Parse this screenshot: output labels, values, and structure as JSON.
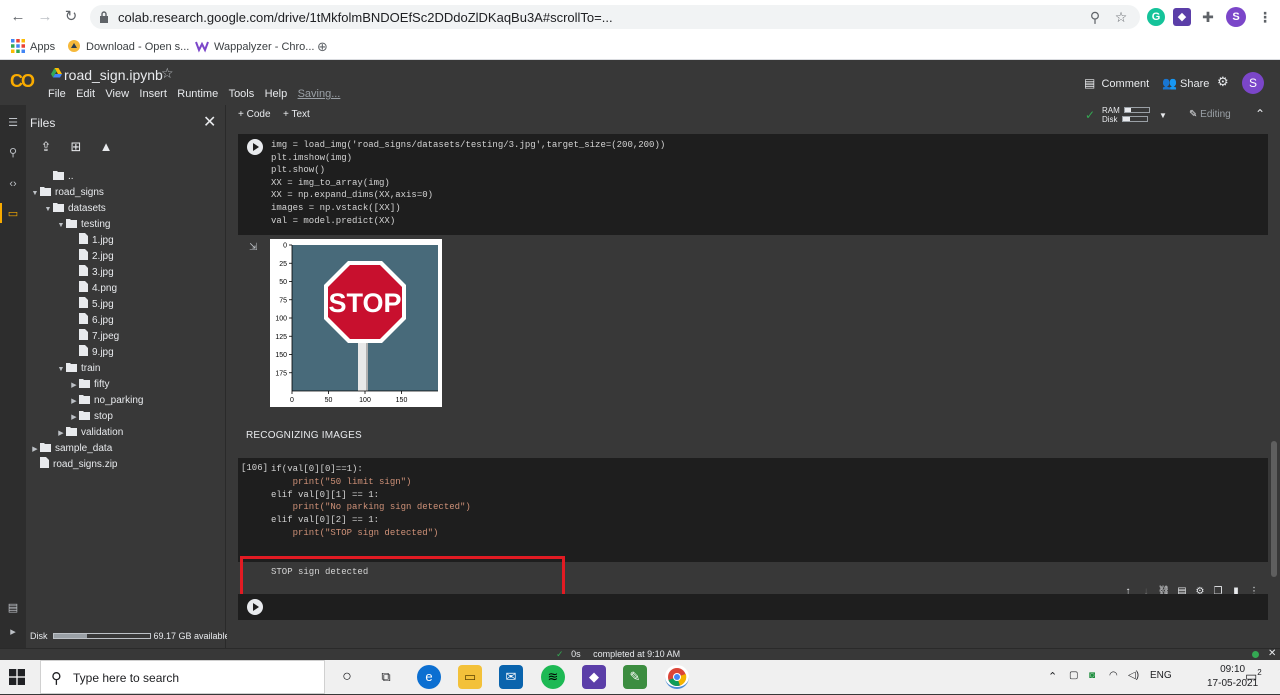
{
  "browser": {
    "url": "colab.research.google.com/drive/1tMkfolmBNDOEfSc2DDdoZlDKaqBu3A#scrollTo=..."
  },
  "bookmarks": [
    {
      "label": "Apps"
    },
    {
      "label": "Download - Open s..."
    },
    {
      "label": "Wappalyzer - Chro..."
    }
  ],
  "colab": {
    "logo": "CO",
    "notebook_title": "road_sign.ipynb",
    "menu": [
      "File",
      "Edit",
      "View",
      "Insert",
      "Runtime",
      "Tools",
      "Help"
    ],
    "saving": "Saving...",
    "comment_label": "Comment",
    "share_label": "Share",
    "avatar_letter": "S"
  },
  "files_panel": {
    "title": "Files",
    "tree": [
      {
        "label": "..",
        "type": "folder-up",
        "depth": 1
      },
      {
        "label": "road_signs",
        "type": "folder",
        "depth": 0,
        "open": true
      },
      {
        "label": "datasets",
        "type": "folder",
        "depth": 1,
        "open": true
      },
      {
        "label": "testing",
        "type": "folder",
        "depth": 2,
        "open": true
      },
      {
        "label": "1.jpg",
        "type": "file",
        "depth": 3
      },
      {
        "label": "2.jpg",
        "type": "file",
        "depth": 3
      },
      {
        "label": "3.jpg",
        "type": "file",
        "depth": 3
      },
      {
        "label": "4.png",
        "type": "file",
        "depth": 3
      },
      {
        "label": "5.jpg",
        "type": "file",
        "depth": 3
      },
      {
        "label": "6.jpg",
        "type": "file",
        "depth": 3
      },
      {
        "label": "7.jpeg",
        "type": "file",
        "depth": 3
      },
      {
        "label": "9.jpg",
        "type": "file",
        "depth": 3
      },
      {
        "label": "train",
        "type": "folder",
        "depth": 2,
        "open": true
      },
      {
        "label": "fifty",
        "type": "folder",
        "depth": 3,
        "open": false
      },
      {
        "label": "no_parking",
        "type": "folder",
        "depth": 3,
        "open": false
      },
      {
        "label": "stop",
        "type": "folder",
        "depth": 3,
        "open": false
      },
      {
        "label": "validation",
        "type": "folder",
        "depth": 2,
        "open": false
      },
      {
        "label": "sample_data",
        "type": "folder",
        "depth": 0,
        "open": false
      },
      {
        "label": "road_signs.zip",
        "type": "file",
        "depth": 0
      }
    ],
    "disk_label": "Disk",
    "disk_available": "69.17 GB available",
    "disk_used_fraction": 0.35
  },
  "toolbar": {
    "add_code": "+ Code",
    "add_text": "+ Text",
    "ram_label": "RAM",
    "disk_label": "Disk",
    "editing_label": "Editing",
    "ram_fraction": 0.25,
    "disk_fraction": 0.3
  },
  "cell1": {
    "lines": [
      "img = load_img('road_signs/datasets/testing/3.jpg',target_size=(200,200))",
      "plt.imshow(img)",
      "plt.show()",
      "XX = img_to_array(img)",
      "XX = np.expand_dims(XX,axis=0)",
      "images = np.vstack([XX])",
      "val = model.predict(XX)"
    ]
  },
  "plot": {
    "y_ticks": [
      "0",
      "25",
      "50",
      "75",
      "100",
      "125",
      "150",
      "175"
    ],
    "x_ticks": [
      "0",
      "50",
      "100",
      "150"
    ],
    "sign_text": "STOP"
  },
  "section_heading": "RECOGNIZING IMAGES",
  "cell2": {
    "exec_count": "[106]",
    "lines": [
      "if(val[0][0]==1):",
      "    print(\"50 limit sign\")",
      "elif val[0][1] == 1:",
      "    print(\"No parking sign detected\")",
      "elif val[0][2] == 1:",
      "    print(\"STOP sign detected\")"
    ],
    "output": "STOP sign detected"
  },
  "status": {
    "check": "✓",
    "duration": "0s",
    "completed": "completed at 9:10 AM"
  },
  "taskbar": {
    "search_placeholder": "Type here to search",
    "lang": "ENG",
    "time": "09:10",
    "date": "17-05-2021",
    "notif_count": "2"
  },
  "colors": {
    "accent": "#f9ab00",
    "highlight": "#e21b23",
    "sign_red": "#c8102e",
    "plot_bg": "#486a7a"
  }
}
